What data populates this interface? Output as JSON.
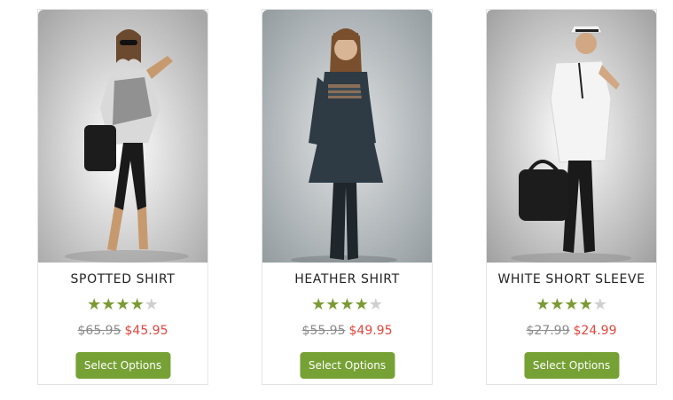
{
  "products": [
    {
      "name": "SPOTTED SHIRT",
      "rating": 4,
      "rating_max": 5,
      "old_price": "$65.95",
      "sale_price": "$45.95",
      "button_label": "Select Options"
    },
    {
      "name": "HEATHER SHIRT",
      "rating": 4,
      "rating_max": 5,
      "old_price": "$55.95",
      "sale_price": "$49.95",
      "button_label": "Select Options"
    },
    {
      "name": "WHITE SHORT SLEEVE",
      "rating": 4,
      "rating_max": 5,
      "old_price": "$27.99",
      "sale_price": "$24.99",
      "button_label": "Select Options"
    }
  ],
  "colors": {
    "accent_green": "#76a135",
    "star_on": "#7a9a33",
    "star_off": "#cfcfcf",
    "sale_red": "#e0463e",
    "old_price_gray": "#8a8a8a"
  }
}
